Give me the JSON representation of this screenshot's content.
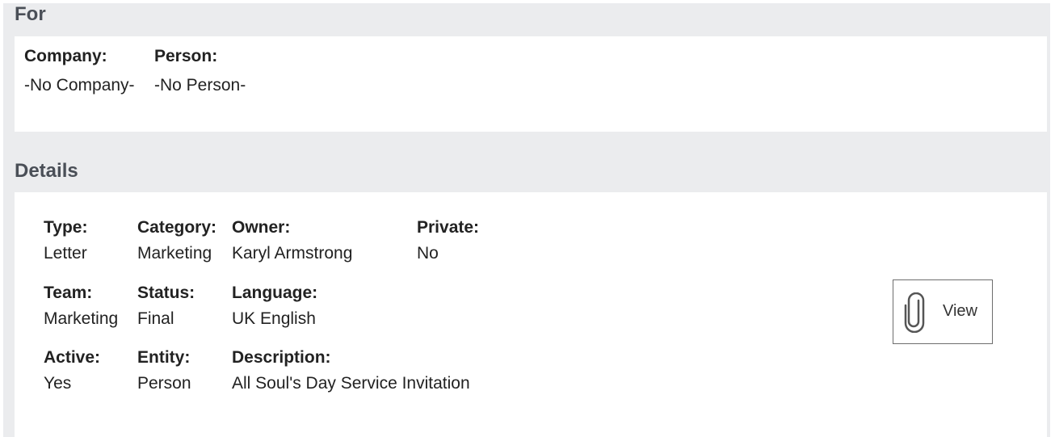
{
  "for_section": {
    "title": "For",
    "company_label": "Company:",
    "company_value": "-No Company-",
    "person_label": "Person:",
    "person_value": "-No Person-"
  },
  "details_section": {
    "title": "Details",
    "type_label": "Type:",
    "type_value": "Letter",
    "category_label": "Category:",
    "category_value": "Marketing",
    "owner_label": "Owner:",
    "owner_value": "Karyl Armstrong",
    "private_label": "Private:",
    "private_value": "No",
    "team_label": "Team:",
    "team_value": "Marketing",
    "status_label": "Status:",
    "status_value": "Final",
    "language_label": "Language:",
    "language_value": "UK English",
    "active_label": "Active:",
    "active_value": "Yes",
    "entity_label": "Entity:",
    "entity_value": "Person",
    "description_label": "Description:",
    "description_value": "All Soul's Day Service Invitation"
  },
  "view_button": {
    "label": "View",
    "icon": "paperclip-icon"
  }
}
